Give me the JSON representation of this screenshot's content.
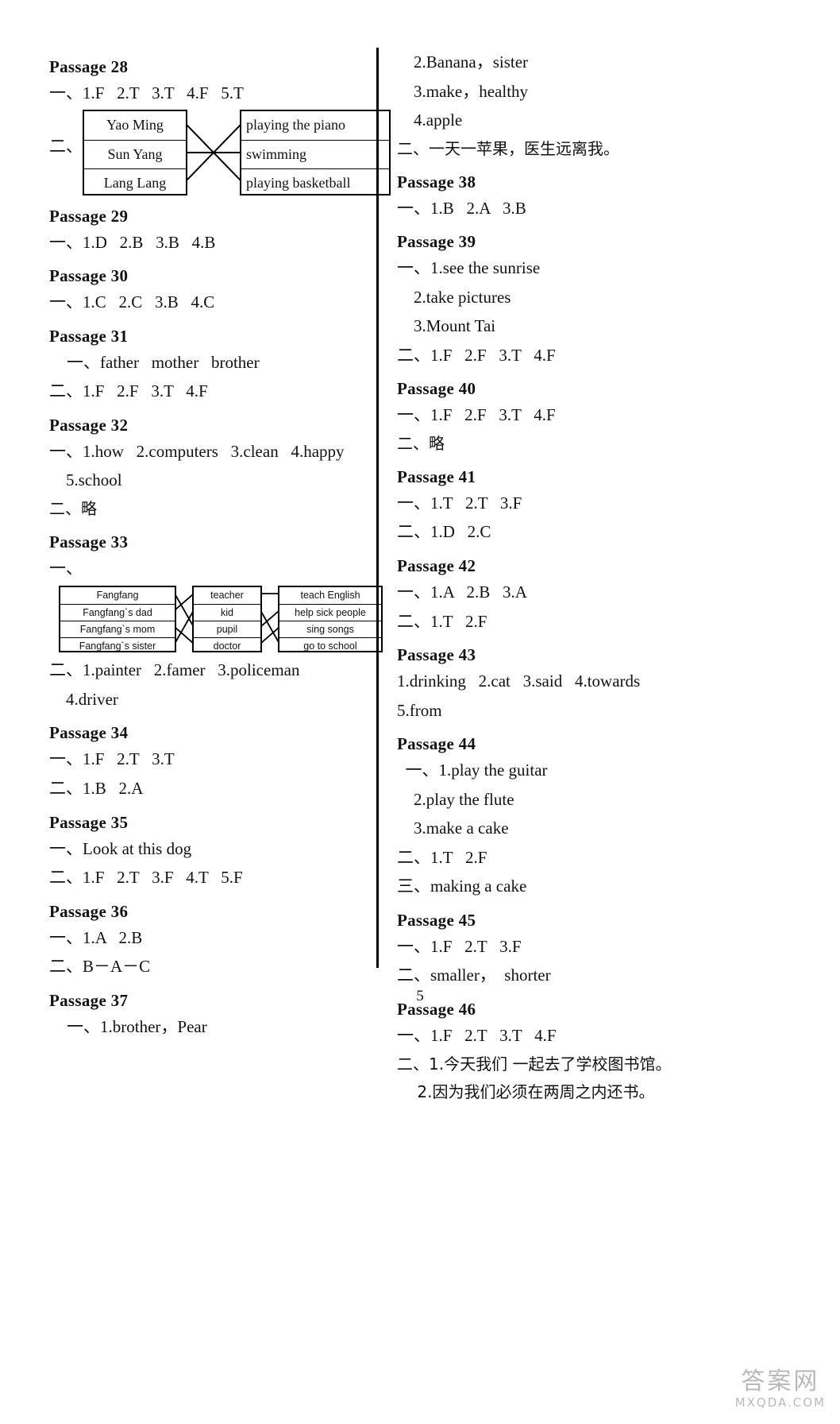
{
  "page": {
    "number": "5",
    "watermark_cn": "答案网",
    "watermark_en": "MXQDA.COM"
  },
  "left_column": {
    "passages": [
      {
        "title": "Passage 28",
        "lines": [
          "一、1.F   2.T   3.T   4.F   5.T"
        ],
        "diagram_label": "二、",
        "diagram": {
          "left_items": [
            "Yao Ming",
            "Sun Yang",
            "Lang Lang"
          ],
          "right_items": [
            "playing the piano",
            "swimming",
            "playing basketball"
          ],
          "connections": [
            [
              0,
              2
            ],
            [
              1,
              1
            ],
            [
              2,
              0
            ]
          ]
        }
      },
      {
        "title": "Passage 29",
        "lines": [
          "一、1.D   2.B   3.B   4.B"
        ]
      },
      {
        "title": "Passage 30",
        "lines": [
          "一、1.C   2.C   3.B   4.C"
        ]
      },
      {
        "title": "Passage 31",
        "lines": [
          "一、father   mother   brother",
          "二、1.F   2.F   3.T   4.F"
        ]
      },
      {
        "title": "Passage 32",
        "lines": [
          "一、1.how   2.computers   3.clean   4.happy",
          "    5.school",
          "二、略"
        ]
      },
      {
        "title": "Passage 33",
        "diagram_label": "一、",
        "diagram3": {
          "col1": [
            "Fangfang",
            "Fangfang`s dad",
            "Fangfang`s mom",
            "Fangfang`s sister"
          ],
          "col2": [
            "teacher",
            "kid",
            "pupil",
            "doctor"
          ],
          "col3": [
            "teach English",
            "help sick people",
            "sing songs",
            "go to school"
          ],
          "links_a": [
            [
              0,
              2
            ],
            [
              1,
              0
            ],
            [
              2,
              3
            ],
            [
              3,
              1
            ]
          ],
          "links_b": [
            [
              0,
              0
            ],
            [
              1,
              3
            ],
            [
              2,
              1
            ],
            [
              3,
              2
            ]
          ]
        },
        "lines": [
          "二、1.painter   2.famer   3.policeman",
          "    4.driver"
        ]
      },
      {
        "title": "Passage 34",
        "lines": [
          "一、1.F   2.T   3.T",
          "二、1.B   2.A"
        ]
      },
      {
        "title": "Passage 35",
        "lines": [
          "一、Look at this dog",
          "二、1.F   2.T   3.F   4.T   5.F"
        ]
      },
      {
        "title": "Passage 36",
        "lines": [
          "一、1.A   2.B",
          "二、B－A－C"
        ]
      },
      {
        "title": "Passage 37",
        "lines": [
          "一、1.brother，Pear"
        ]
      }
    ]
  },
  "right_column": {
    "passages": [
      {
        "title": "",
        "lines": [
          "    2.Banana，sister",
          "    3.make，healthy",
          "    4.apple",
          "二、一天一苹果，医生远离我。"
        ]
      },
      {
        "title": "Passage 38",
        "lines": [
          "一、1.B   2.A   3.B"
        ]
      },
      {
        "title": "Passage 39",
        "lines": [
          "一、1.see the sunrise",
          "    2.take pictures",
          "    3.Mount Tai",
          "二、1.F   2.F   3.T   4.F"
        ]
      },
      {
        "title": "Passage 40",
        "lines": [
          "一、1.F   2.F   3.T   4.F",
          "二、略"
        ]
      },
      {
        "title": "Passage 41",
        "lines": [
          "一、1.T   2.T   3.F",
          "二、1.D   2.C"
        ]
      },
      {
        "title": "Passage 42",
        "lines": [
          "一、1.A   2.B   3.A",
          "二、1.T   2.F"
        ]
      },
      {
        "title": "Passage 43",
        "lines": [
          "1.drinking   2.cat   3.said   4.towards",
          "5.from"
        ]
      },
      {
        "title": "Passage 44",
        "lines": [
          "  一、1.play the guitar",
          "    2.play the flute",
          "    3.make a cake",
          "二、1.T   2.F",
          "三、making a cake"
        ]
      },
      {
        "title": "Passage 45",
        "lines": [
          "一、1.F   2.T   3.F",
          "二、smaller，  shorter"
        ]
      },
      {
        "title": "Passage 46",
        "lines": [
          "一、1.F   2.T   3.T   4.F",
          "二、1.今天我们 一起去了学校图书馆。",
          "    2.因为我们必须在两周之内还书。"
        ]
      }
    ]
  }
}
